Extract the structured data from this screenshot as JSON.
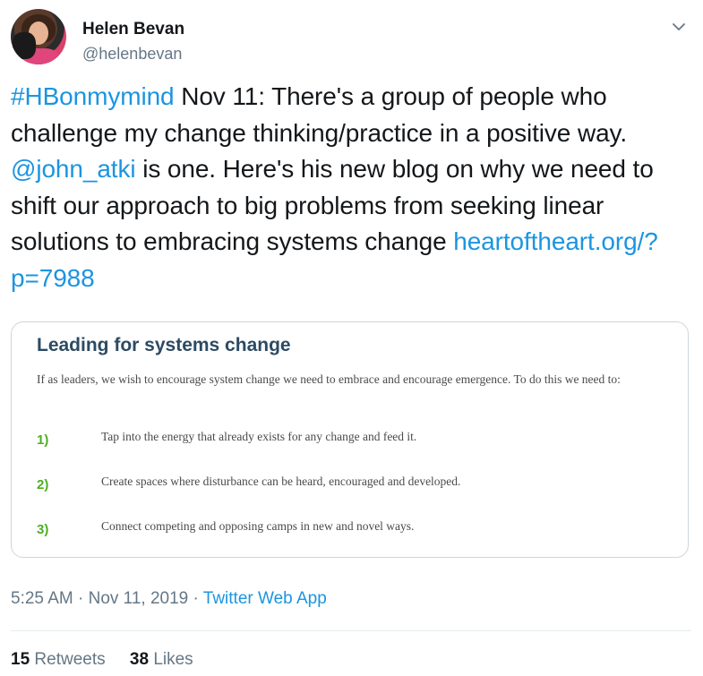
{
  "user": {
    "name": "Helen Bevan",
    "handle": "@helenbevan"
  },
  "tweet": {
    "hashtag": "#HBonmymind",
    "text_1": " Nov 11: There's a group of people who challenge my change thinking/practice in a positive way. ",
    "mention": "@john_atki",
    "text_2": " is one. Here's his new blog on why we need to shift our approach to big problems from seeking linear solutions to embracing systems change ",
    "link": "heartoftheart.org/?p=7988"
  },
  "card": {
    "title": "Leading for systems change",
    "intro": "If as leaders, we wish to encourage system change we need to embrace and encourage emergence. To do this we need to:",
    "items": [
      {
        "num": "1)",
        "text": "Tap into the energy that already exists for any change and feed it."
      },
      {
        "num": "2)",
        "text": "Create spaces where disturbance can be heard, encouraged and developed."
      },
      {
        "num": "3)",
        "text": "Connect competing and opposing camps in new and novel ways."
      }
    ]
  },
  "meta": {
    "time": "5:25 AM",
    "sep1": " · ",
    "date": "Nov 11, 2019",
    "sep2": " · ",
    "app": "Twitter Web App"
  },
  "stats": {
    "retweets_count": "15",
    "retweets_label": "Retweets",
    "likes_count": "38",
    "likes_label": "Likes"
  },
  "colors": {
    "link": "#1b95e0",
    "secondary_text": "#657786",
    "card_title": "#2c4a63",
    "list_number": "#4caf20"
  },
  "icons": {
    "caret": "chevron-down-icon"
  }
}
